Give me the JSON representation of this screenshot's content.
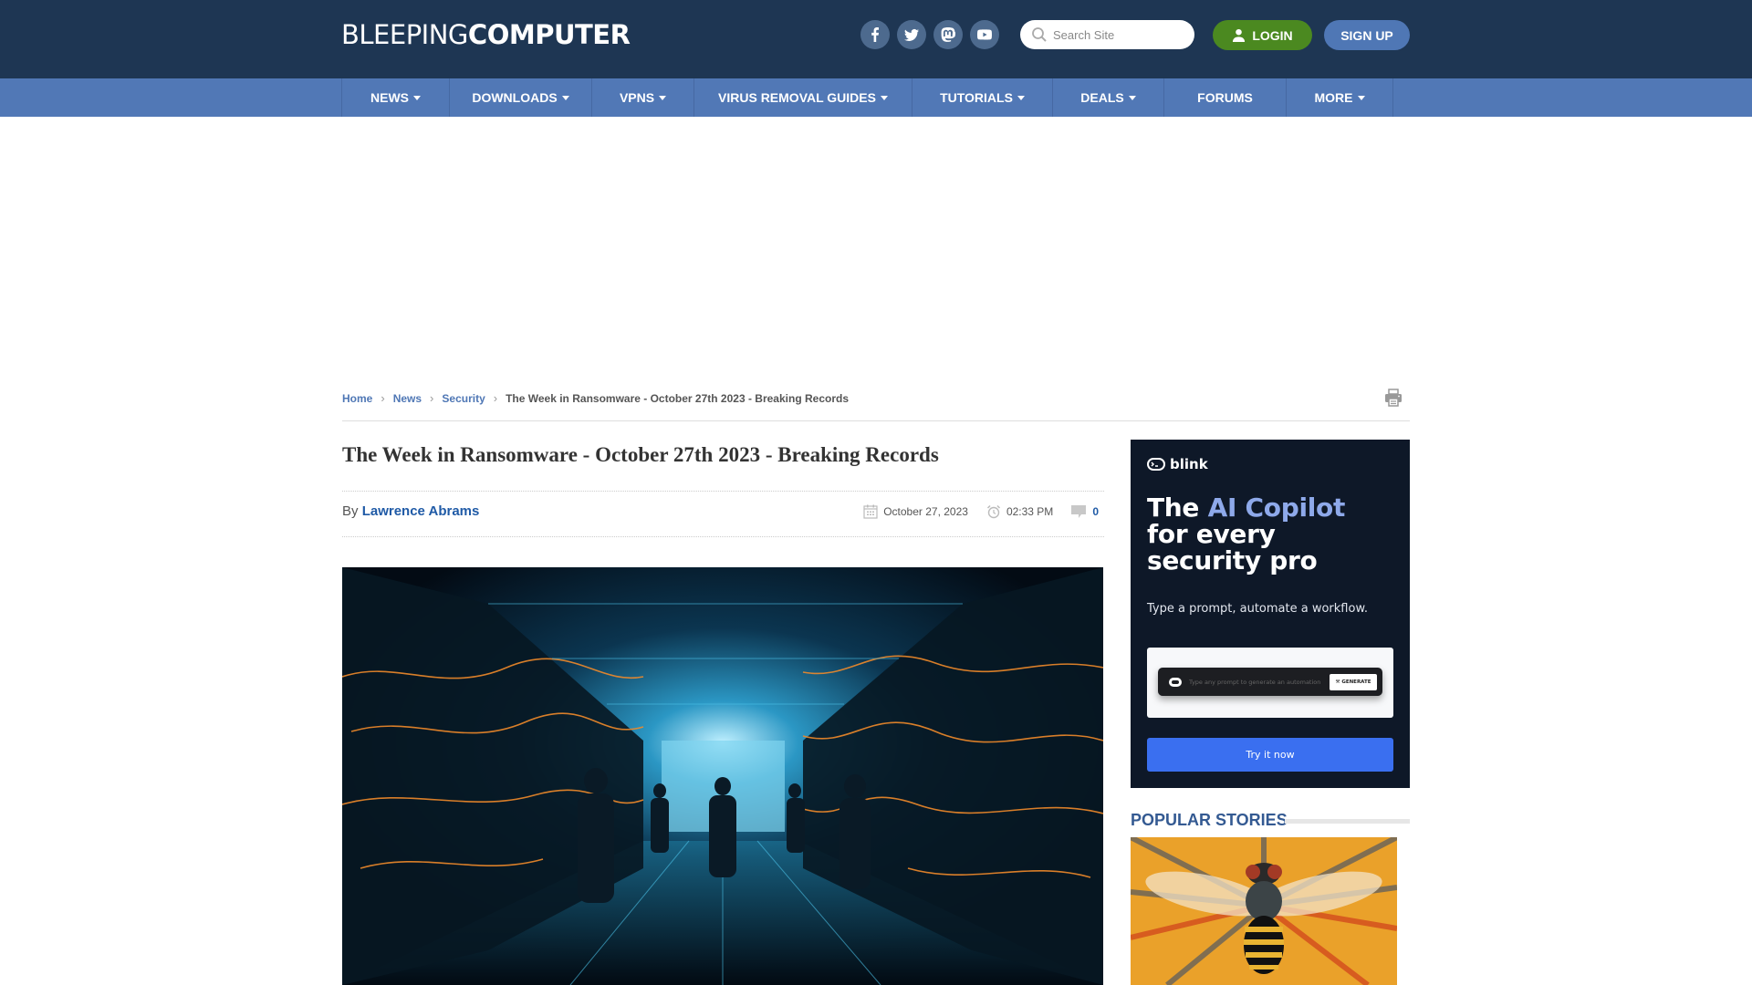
{
  "header": {
    "logo_light": "BLEEPING",
    "logo_bold": "COMPUTER",
    "socials": [
      {
        "name": "facebook",
        "icon": "facebook-icon"
      },
      {
        "name": "twitter",
        "icon": "twitter-icon"
      },
      {
        "name": "mastodon",
        "icon": "mastodon-icon"
      },
      {
        "name": "youtube",
        "icon": "youtube-icon"
      }
    ],
    "search_placeholder": "Search Site",
    "login_label": "LOGIN",
    "signup_label": "SIGN UP"
  },
  "nav": {
    "items": [
      {
        "label": "NEWS",
        "dropdown": true
      },
      {
        "label": "DOWNLOADS",
        "dropdown": true
      },
      {
        "label": "VPNS",
        "dropdown": true
      },
      {
        "label": "VIRUS REMOVAL GUIDES",
        "dropdown": true
      },
      {
        "label": "TUTORIALS",
        "dropdown": true
      },
      {
        "label": "DEALS",
        "dropdown": true
      },
      {
        "label": "FORUMS",
        "dropdown": false
      },
      {
        "label": "MORE",
        "dropdown": true
      }
    ]
  },
  "breadcrumb": {
    "items": [
      "Home",
      "News",
      "Security"
    ],
    "current": "The Week in Ransomware - October 27th 2023 - Breaking Records"
  },
  "article": {
    "title": "The Week in Ransomware - October 27th 2023 - Breaking Records",
    "by_prefix": "By",
    "author": "Lawrence Abrams",
    "date": "October 27, 2023",
    "time": "02:33 PM",
    "comment_count": "0",
    "hero_image": "data-center-corridor-illustration"
  },
  "sidebar": {
    "ad": {
      "brand": "blink",
      "headline_plain": "The ",
      "headline_accent": "AI Copilot",
      "headline_rest_1": "for every",
      "headline_rest_2": "security pro",
      "subtext": "Type a prompt, automate a workflow.",
      "prompt_placeholder": "Type any prompt to generate an automation",
      "generate_label": "GENERATE",
      "cta_label": "Try it now",
      "accent_color": "#8ea9ea",
      "cta_color": "#3a6ff0"
    },
    "popular": {
      "title": "POPULAR STORIES",
      "first_image": "fly-illustration-orange"
    }
  },
  "colors": {
    "header_bg": "#1e3653",
    "nav_bg": "#5178b6",
    "login_bg": "#4b8920",
    "signup_bg": "#4f77b5",
    "link": "#1f5aa6"
  }
}
